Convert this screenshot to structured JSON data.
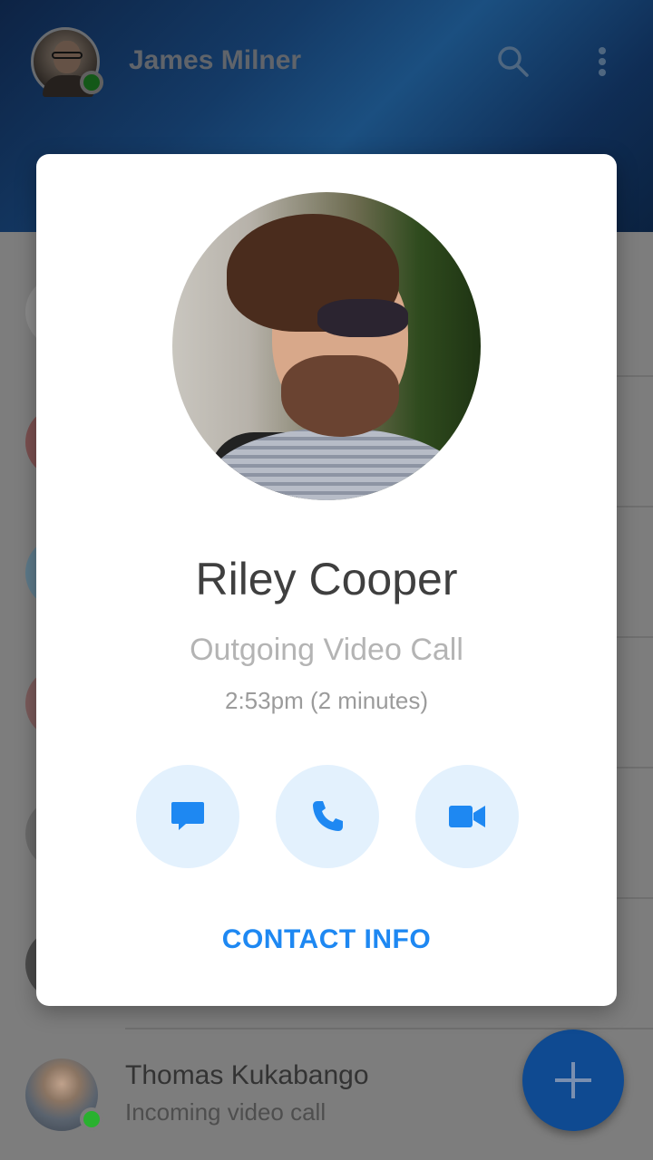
{
  "header": {
    "user_name": "James Milner",
    "search_icon": "search-icon",
    "menu_icon": "more-vertical-icon"
  },
  "list": {
    "bottom_item": {
      "name": "Thomas Kukabango",
      "subtitle": "Incoming video call"
    }
  },
  "fab": {
    "icon": "plus-icon"
  },
  "dialog": {
    "contact_name": "Riley Cooper",
    "call_type": "Outgoing Video Call",
    "call_time": "2:53pm (2 minutes)",
    "actions": [
      {
        "icon": "message-icon"
      },
      {
        "icon": "phone-icon"
      },
      {
        "icon": "video-camera-icon"
      }
    ],
    "contact_info_label": "CONTACT INFO"
  },
  "colors": {
    "accent": "#1e88f2",
    "action_bg": "#e3f1fd",
    "online": "#29b12f"
  }
}
